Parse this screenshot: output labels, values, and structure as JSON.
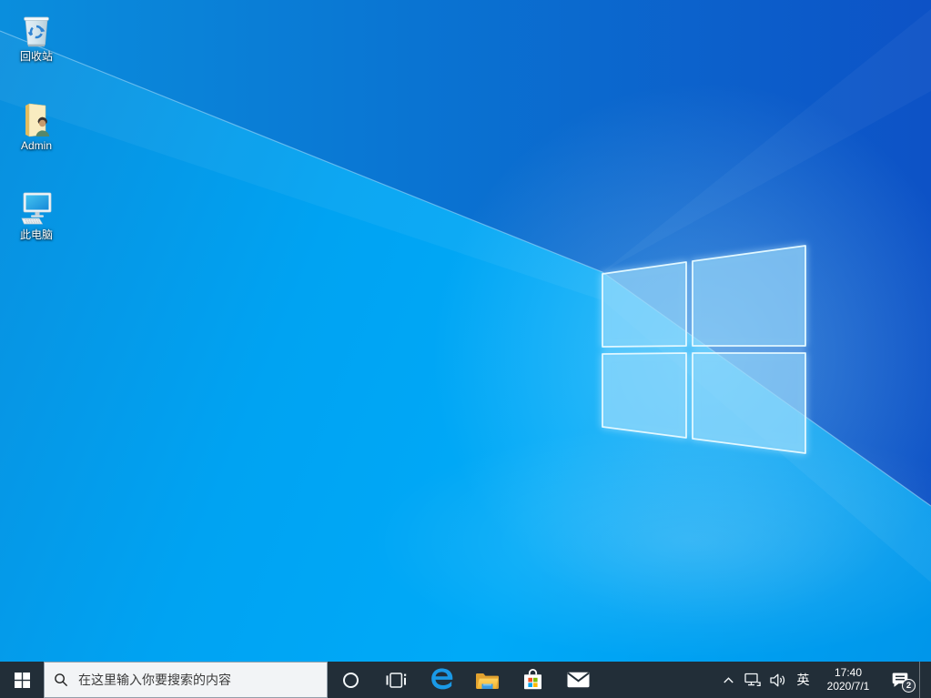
{
  "desktop": {
    "icons": [
      {
        "name": "recycle-bin",
        "label": "回收站"
      },
      {
        "name": "admin-user-folder",
        "label": "Admin"
      },
      {
        "name": "this-pc",
        "label": "此电脑"
      }
    ]
  },
  "taskbar": {
    "search": {
      "placeholder": "在这里输入你要搜索的内容"
    },
    "app_buttons": [
      "start",
      "cortana",
      "task-view",
      "edge",
      "file-explorer",
      "store",
      "mail"
    ],
    "tray": {
      "ime_label": "英",
      "clock": {
        "time": "17:40",
        "date": "2020/7/1"
      },
      "notification_count": "2"
    }
  },
  "colors": {
    "taskbar_bg": "#222e38",
    "wallpaper_azure": "#00aaf8",
    "wallpaper_deep_blue": "#0d52c6",
    "logo_glow": "#d9f6ff",
    "search_bg": "#f2f4f6",
    "edge_blue": "#1a99e6",
    "store_red": "#f25022",
    "store_green": "#7fba00",
    "store_blue": "#00a4ef",
    "store_yellow": "#ffb900",
    "explorer_yellow": "#ffd45f",
    "explorer_tray_blue": "#3b9ae1"
  }
}
